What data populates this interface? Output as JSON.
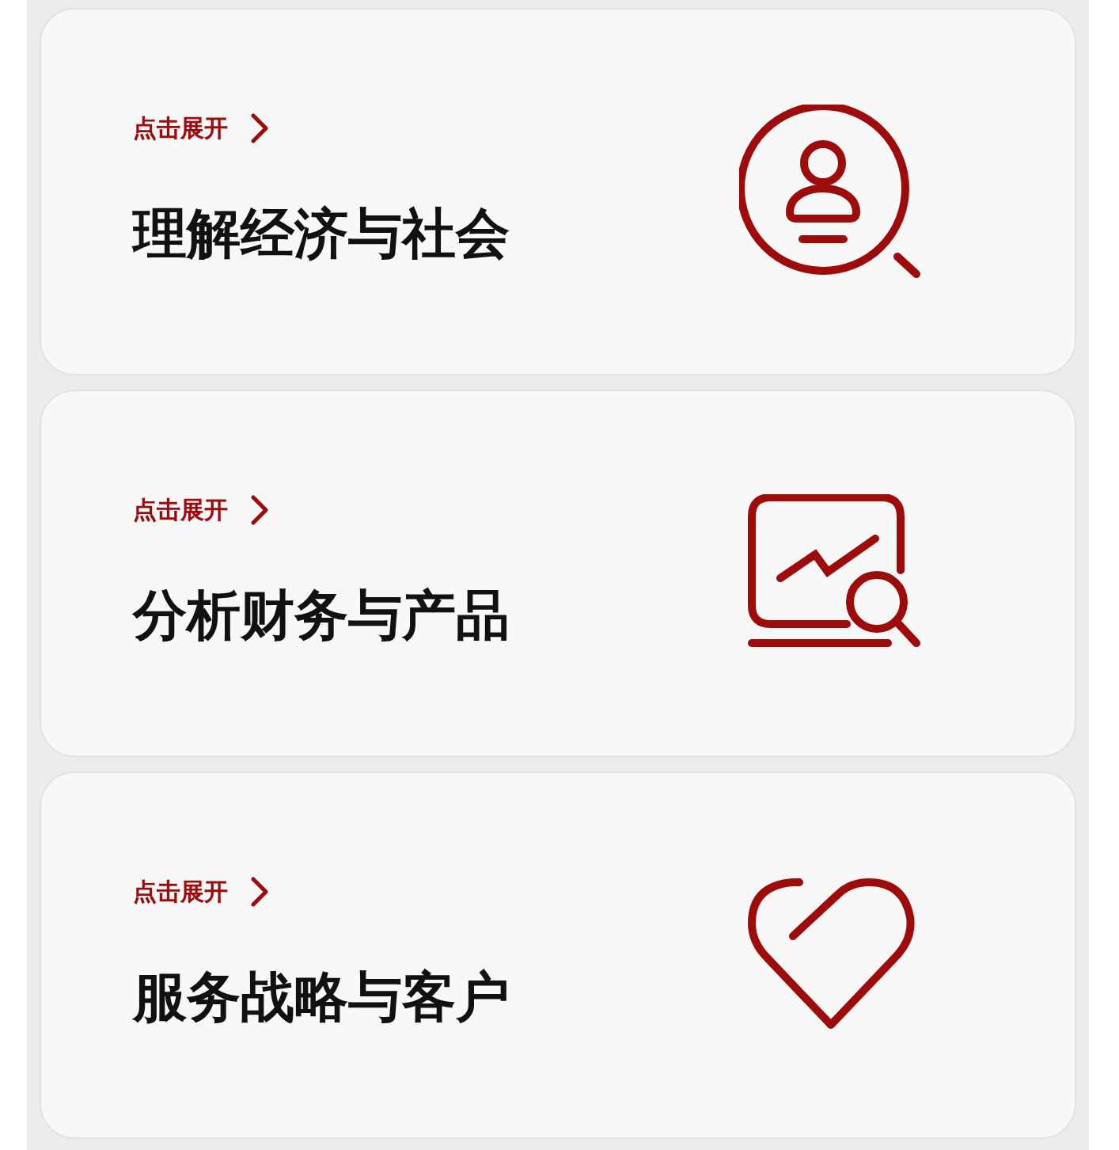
{
  "cards": [
    {
      "expand_label": "点击展开",
      "title": "理解经济与社会",
      "kind": "person-search"
    },
    {
      "expand_label": "点击展开",
      "title": "分析财务与产品",
      "kind": "chart-search"
    },
    {
      "expand_label": "点击展开",
      "title": "服务战略与客户",
      "kind": "heart"
    }
  ]
}
